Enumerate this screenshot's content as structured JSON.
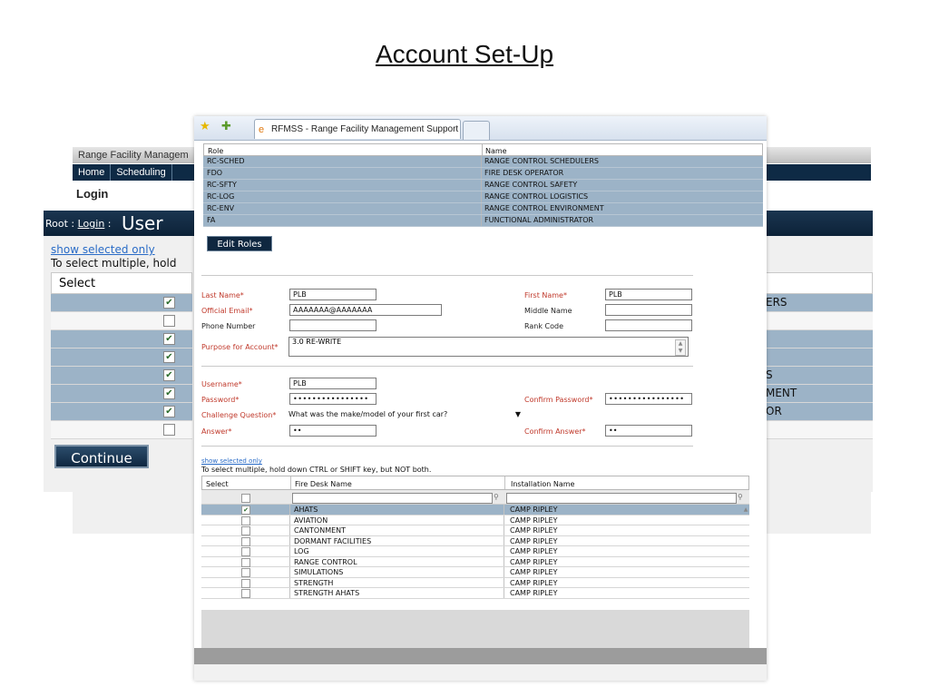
{
  "slide": {
    "title": "Account Set-Up"
  },
  "background_app": {
    "banner": "Range Facility Managem",
    "nav": [
      "Home",
      "Scheduling"
    ],
    "login_heading": "Login",
    "breadcrumb_root": "Root : ",
    "breadcrumb_login": "Login",
    "breadcrumb_sep": " : ",
    "page_heading": "User",
    "show_selected": "show selected only",
    "to_select": "To select multiple, hold",
    "select_header": "Select",
    "rows_checked": [
      true,
      false,
      true,
      true,
      true,
      true,
      true,
      false
    ],
    "right_partial": [
      "ERS",
      "",
      "",
      "",
      "S",
      "MENT",
      "OR",
      ""
    ],
    "continue_label": "Continue"
  },
  "browser": {
    "tab_title": "RFMSS - Range Facility Management Support Sys...",
    "icons": [
      "favorites-star-icon",
      "add-favorite-icon",
      "ie-page-icon"
    ]
  },
  "roles": {
    "columns": [
      "Role",
      "Name"
    ],
    "rows": [
      [
        "RC-SCHED",
        "RANGE CONTROL SCHEDULERS"
      ],
      [
        "FDO",
        "FIRE DESK OPERATOR"
      ],
      [
        "RC-SFTY",
        "RANGE CONTROL SAFETY"
      ],
      [
        "RC-LOG",
        "RANGE CONTROL LOGISTICS"
      ],
      [
        "RC-ENV",
        "RANGE CONTROL ENVIRONMENT"
      ],
      [
        "FA",
        "FUNCTIONAL ADMINISTRATOR"
      ]
    ],
    "edit_button": "Edit Roles"
  },
  "form": {
    "last_name_label": "Last Name*",
    "last_name": "PLB",
    "first_name_label": "First Name*",
    "first_name": "PLB",
    "email_label": "Official Email*",
    "email": "AAAAAAA@AAAAAAA",
    "middle_label": "Middle Name",
    "middle": "",
    "phone_label": "Phone Number",
    "phone": "",
    "rank_label": "Rank Code",
    "rank": "",
    "purpose_label": "Purpose for Account*",
    "purpose": "3.0 RE-WRITE",
    "username_label": "Username*",
    "username": "PLB",
    "password_label": "Password*",
    "password": "••••••••••••••••",
    "confirm_password_label": "Confirm Password*",
    "confirm_password": "••••••••••••••••",
    "challenge_label": "Challenge Question*",
    "challenge": "What was the make/model of your first car?",
    "answer_label": "Answer*",
    "answer": "••",
    "confirm_answer_label": "Confirm Answer*",
    "confirm_answer": "••"
  },
  "fire_desk": {
    "show_selected": "show selected only",
    "to_select": "To select multiple, hold down CTRL or SHIFT key, but NOT both.",
    "columns": [
      "Select",
      "Fire Desk Name",
      "Installation Name"
    ],
    "rows": [
      {
        "checked": true,
        "name": "AHATS",
        "installation": "CAMP RIPLEY"
      },
      {
        "checked": false,
        "name": "AVIATION",
        "installation": "CAMP RIPLEY"
      },
      {
        "checked": false,
        "name": "CANTONMENT",
        "installation": "CAMP RIPLEY"
      },
      {
        "checked": false,
        "name": "DORMANT FACILITIES",
        "installation": "CAMP RIPLEY"
      },
      {
        "checked": false,
        "name": "LOG",
        "installation": "CAMP RIPLEY"
      },
      {
        "checked": false,
        "name": "RANGE CONTROL",
        "installation": "CAMP RIPLEY"
      },
      {
        "checked": false,
        "name": "SIMULATIONS",
        "installation": "CAMP RIPLEY"
      },
      {
        "checked": false,
        "name": "STRENGTH",
        "installation": "CAMP RIPLEY"
      },
      {
        "checked": false,
        "name": "STRENGTH AHATS",
        "installation": "CAMP RIPLEY"
      }
    ]
  },
  "colors": {
    "selected_row": "#9cb3c7",
    "nav_dark": "#0f2740",
    "required_label": "#c0392b",
    "link": "#2a6cc7"
  }
}
